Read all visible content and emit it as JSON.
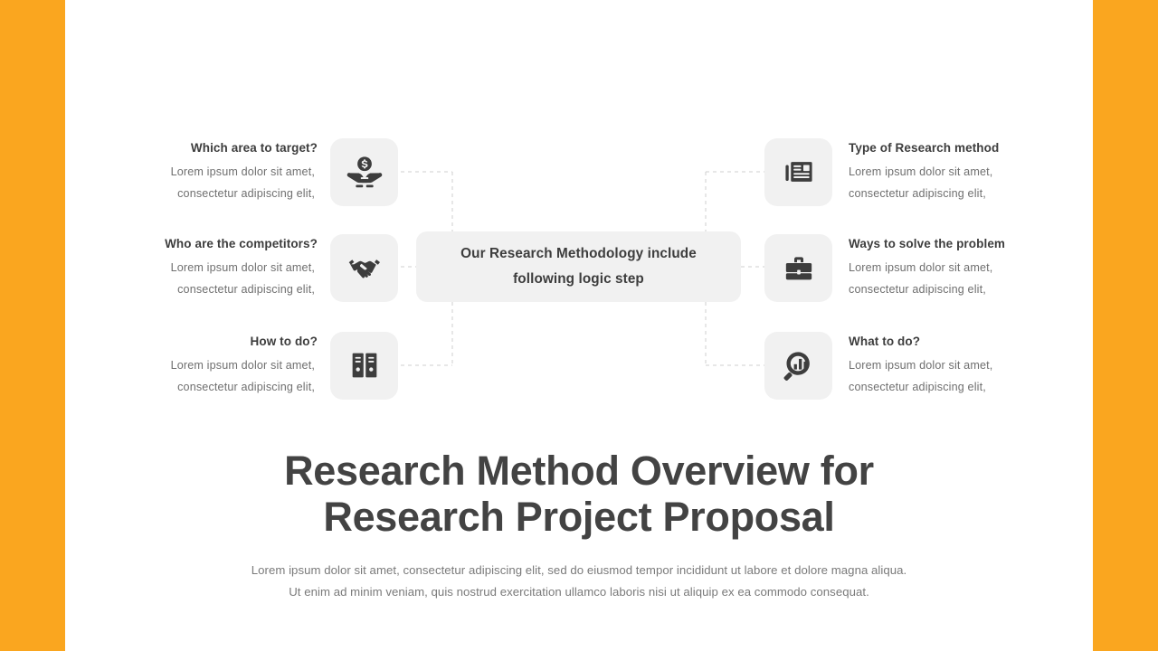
{
  "theme": {
    "accent_color": "#faa61f",
    "tile_bg": "#f1f1f1",
    "icon_color": "#3d3d3d",
    "heading_color": "#434343",
    "body_color": "#6f6f6f",
    "connector_color": "#cfcfcf"
  },
  "center": {
    "line1": "Our Research Methodology include",
    "line2": "following logic step"
  },
  "features_left": [
    {
      "id": "which-area",
      "icon": "money-in-hands-icon",
      "title": "Which area to target?",
      "desc_line1": "Lorem ipsum dolor sit amet,",
      "desc_line2": "consectetur adipiscing elit,"
    },
    {
      "id": "competitors",
      "icon": "handshake-icon",
      "title": "Who are the competitors?",
      "desc_line1": "Lorem ipsum dolor sit amet,",
      "desc_line2": "consectetur adipiscing elit,"
    },
    {
      "id": "how-to-do",
      "icon": "binders-archive-icon",
      "title": "How to do?",
      "desc_line1": "Lorem ipsum dolor sit amet,",
      "desc_line2": "consectetur adipiscing elit,"
    }
  ],
  "features_right": [
    {
      "id": "research-method",
      "icon": "newspaper-icon",
      "title": "Type of Research method",
      "desc_line1": "Lorem ipsum dolor sit amet,",
      "desc_line2": "consectetur adipiscing elit,"
    },
    {
      "id": "ways-to-solve",
      "icon": "briefcase-icon",
      "title": "Ways to solve the problem",
      "desc_line1": "Lorem ipsum dolor sit amet,",
      "desc_line2": "consectetur adipiscing elit,"
    },
    {
      "id": "what-to-do",
      "icon": "magnifier-bar-chart-icon",
      "title": "What to do?",
      "desc_line1": "Lorem ipsum dolor sit amet,",
      "desc_line2": "consectetur adipiscing elit,"
    }
  ],
  "headline": {
    "line1": "Research Method Overview for",
    "line2": "Research Project Proposal"
  },
  "subcopy": {
    "line1": "Lorem ipsum dolor sit amet, consectetur adipiscing elit, sed do eiusmod tempor incididunt ut labore et dolore magna aliqua.",
    "line2": "Ut enim ad minim veniam, quis nostrud exercitation ullamco laboris nisi ut aliquip ex ea commodo consequat."
  }
}
